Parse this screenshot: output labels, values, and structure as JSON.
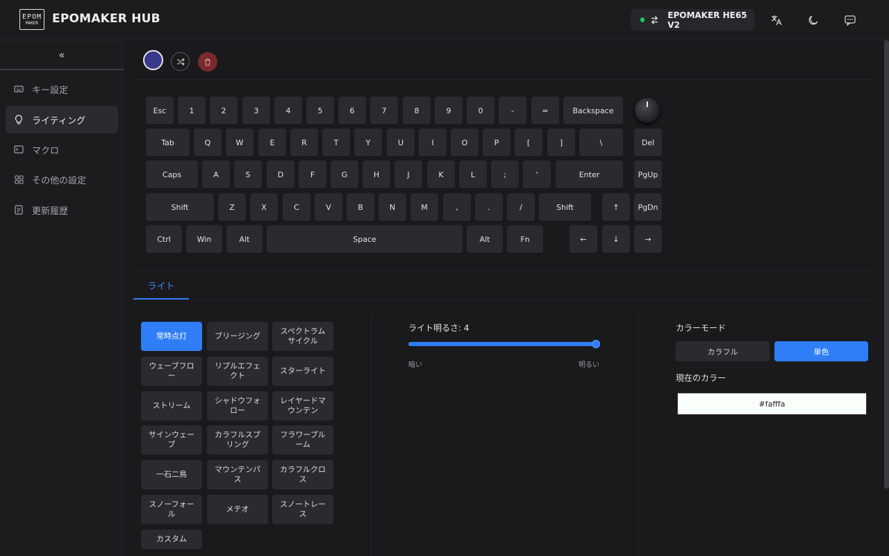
{
  "header": {
    "logo_line1": "EPOM",
    "logo_line2": "MAKER",
    "title": "EPOMAKER HUB",
    "device_name": "EPOMAKER HE65 V2",
    "connected_color": "#20c860"
  },
  "sidebar": {
    "collapse_glyph": "«",
    "items": [
      {
        "label": "キー設定",
        "icon": "keyboard-icon"
      },
      {
        "label": "ライティング",
        "icon": "bulb-icon",
        "active": true
      },
      {
        "label": "マクロ",
        "icon": "terminal-icon"
      },
      {
        "label": "その他の設定",
        "icon": "grid-icon"
      },
      {
        "label": "更新履歴",
        "icon": "document-icon"
      }
    ]
  },
  "toolbar": {
    "swatch_color": "#3a3a8c",
    "shuffle_icon": "shuffle-icon",
    "delete_icon": "trash-icon"
  },
  "keyboard": {
    "row1": [
      "Esc",
      "1",
      "2",
      "3",
      "4",
      "5",
      "6",
      "7",
      "8",
      "9",
      "0",
      "-",
      "=",
      "Backspace"
    ],
    "row2": [
      "Tab",
      "Q",
      "W",
      "E",
      "R",
      "T",
      "Y",
      "U",
      "I",
      "O",
      "P",
      "[",
      "]",
      "\\",
      "Del"
    ],
    "row3": [
      "Caps",
      "A",
      "S",
      "D",
      "F",
      "G",
      "H",
      "J",
      "K",
      "L",
      ";",
      "'",
      "Enter",
      "PgUp"
    ],
    "row4": [
      "Shift",
      "Z",
      "X",
      "C",
      "V",
      "B",
      "N",
      "M",
      ",",
      ".",
      "/",
      "Shift",
      "↑",
      "PgDn"
    ],
    "row5": [
      "Ctrl",
      "Win",
      "Alt",
      "Space",
      "Alt",
      "Fn",
      "←",
      "↓",
      "→"
    ]
  },
  "tabs": {
    "light": "ライト"
  },
  "effects": [
    "常時点灯",
    "ブリージング",
    "スペクトラム\nサイクル",
    "ウェーブフロ\nー",
    "リプルエフェ\nクト",
    "スターライト",
    "ストリーム",
    "シャドウフォ\nロー",
    "レイヤードマ\nウンテン",
    "サインウェー\nブ",
    "カラフルスプ\nリング",
    "フラワープル\nーム",
    "一石二鳥",
    "マウンテンパ\nス",
    "カラフルクロ\nス",
    "スノーフォー\nル",
    "メテオ",
    "スノートレー\nス",
    "カスタム"
  ],
  "selected_effect": "常時点灯",
  "brightness": {
    "label": "ライト明るさ: 4",
    "value": 4,
    "fraction": 1.0,
    "min_label": "暗い",
    "max_label": "明るい"
  },
  "color_mode": {
    "title": "カラーモード",
    "options": [
      "カラフル",
      "単色"
    ],
    "selected": "単色",
    "current_title": "現在のカラー",
    "current_hex": "#fafffa"
  },
  "colors": {
    "accent": "#2f7ef7",
    "delete_red": "#7a2a2e"
  }
}
